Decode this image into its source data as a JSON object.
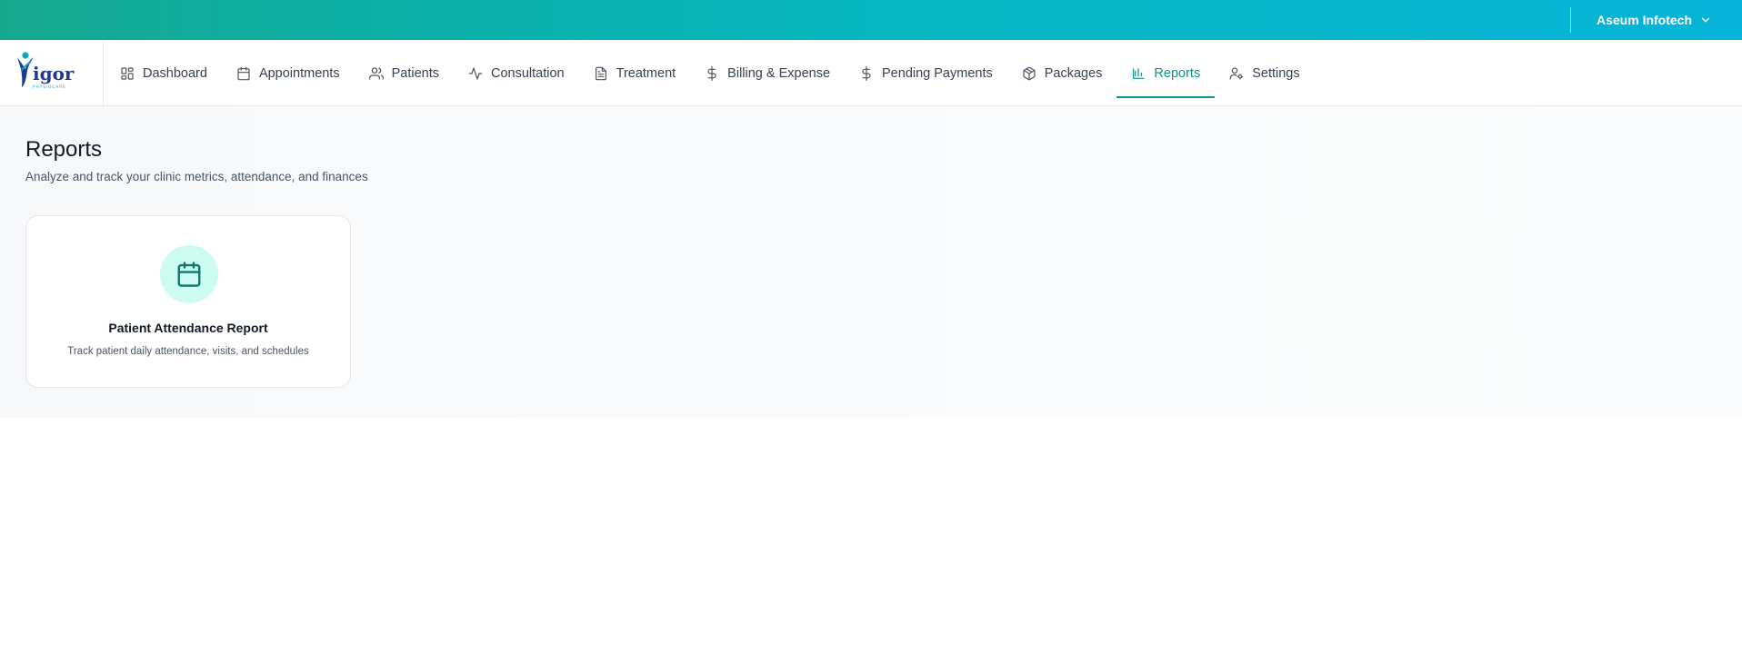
{
  "header": {
    "user_name": "Aseum Infotech"
  },
  "brand": {
    "logo_text": "igor",
    "logo_tagline": "PHYSIOCARE",
    "accent_color": "#0d9488",
    "gradient_start": "#14a98f",
    "gradient_end": "#06b4d8"
  },
  "nav": {
    "items": [
      {
        "label": "Dashboard",
        "icon": "dashboard-icon"
      },
      {
        "label": "Appointments",
        "icon": "calendar-icon"
      },
      {
        "label": "Patients",
        "icon": "users-icon"
      },
      {
        "label": "Consultation",
        "icon": "activity-icon"
      },
      {
        "label": "Treatment",
        "icon": "document-icon"
      },
      {
        "label": "Billing & Expense",
        "icon": "dollar-icon"
      },
      {
        "label": "Pending Payments",
        "icon": "dollar-icon"
      },
      {
        "label": "Packages",
        "icon": "package-icon"
      },
      {
        "label": "Reports",
        "icon": "bar-chart-icon",
        "active": true
      },
      {
        "label": "Settings",
        "icon": "user-cog-icon"
      }
    ]
  },
  "page": {
    "title": "Reports",
    "subtitle": "Analyze and track your clinic metrics, attendance, and finances"
  },
  "reports": [
    {
      "title": "Patient Attendance Report",
      "description": "Track patient daily attendance, visits, and schedules",
      "icon": "calendar-icon"
    }
  ]
}
